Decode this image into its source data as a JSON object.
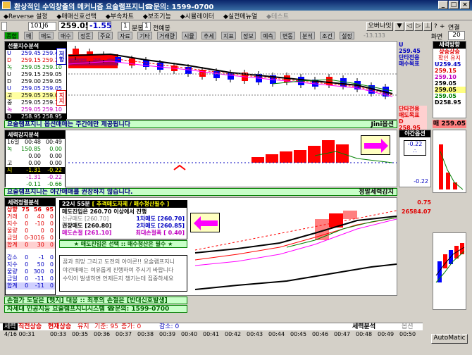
{
  "window": {
    "title": "환상적인 수익창출의 메커니즘 요술램프지니☎문의: 1599-0700",
    "btn_min": "_",
    "btn_max": "□",
    "btn_close": "×"
  },
  "menu": [
    "◆Reverse 설정",
    "◆매매신호선택",
    "◆부속차트",
    "◆보조기능",
    "◆시뮬레이터",
    "◆실전메뉴얼",
    "◆테스트"
  ],
  "toolbar": {
    "code": "101J6",
    "price": "259.05",
    "change": "-1.55",
    "period_value": "1",
    "period_unit": "분봉",
    "interval_value": "1",
    "interval_unit": "전예봉",
    "link_label": "오버나잇",
    "nav_prev": "◁",
    "nav_next": "▷",
    "zoom_label": "화면",
    "zoom_value": "20",
    "link2": "연결",
    "tabs": [
      "종합",
      "매",
      "매도",
      "매수",
      "정돈",
      "주요",
      "자료",
      "기타",
      "거래량",
      "시뮬",
      "추세",
      "지표",
      "정보",
      "예측",
      "변동",
      "분석",
      "조건",
      "설정"
    ],
    "tab_value": "-13.133"
  },
  "top_panel": {
    "header": "선물지수분석",
    "rows": [
      {
        "k": "U",
        "v1": "259.45",
        "v2": "259.45"
      },
      {
        "k": "D",
        "v1": "259.15",
        "v2": "259.20"
      },
      {
        "k": "녹",
        "v1": "259.05",
        "v2": "259.10"
      },
      {
        "k": "U",
        "v1": "259.15",
        "v2": "259.05"
      },
      {
        "k": "D",
        "v1": "259.00",
        "v2": "259.05"
      },
      {
        "k": "U",
        "v1": "259.05",
        "v2": "259.05"
      },
      {
        "k": "고",
        "v1": "259.05",
        "v2": "259.05"
      },
      {
        "k": "중",
        "v1": "259.05",
        "v2": "259.10"
      },
      {
        "k": "녹",
        "v1": "259.05",
        "v2": "259.10"
      },
      {
        "k": "D",
        "v1": "258.95",
        "v2": "258.95"
      },
      {
        "k": "흑",
        "v1": "0.49",
        "v2": "0.49"
      }
    ],
    "side_top": "저항",
    "side_bottom": "지지",
    "strip": "요술램프지니 옵션매매는 주간에만 제공됩니다",
    "strip_right": "Jini옵션"
  },
  "top_right": {
    "u_label": "U 259.45",
    "line2": "단타전용",
    "line3": "매수목표",
    "mid_label": "단타전용",
    "mid_label2": "매도목표",
    "d_label": "D 258.95",
    "tag": "매 259.05"
  },
  "right_column": {
    "header": "세력방향",
    "sub1": "상승상승",
    "sub2": "확인 유지",
    "values": [
      "U259.45",
      "259.15",
      "259.10",
      "259.05",
      "259.05",
      "259.05",
      "D258.95"
    ]
  },
  "mid_panel": {
    "header": "세력강지분석",
    "rows": [
      {
        "k": "16일",
        "v1": "00:48",
        "v2": "00:49"
      },
      {
        "k": "녹",
        "v1": "150.85",
        "v2": "0.00"
      },
      {
        "k": "",
        "v1": "0.00",
        "v2": "0.00"
      },
      {
        "k": "고",
        "v1": "0.00",
        "v2": "0.00"
      },
      {
        "k": "지",
        "v1": "-1.31",
        "v2": "-0.22"
      },
      {
        "k": "",
        "v1": "-1.31",
        "v2": "-0.22"
      },
      {
        "k": "",
        "v1": "-0.11",
        "v2": "-0.66"
      }
    ],
    "strip": "요술램프지니는 야간매매를 권장하지 않습니다.",
    "strip_right": "정말세력감지",
    "opt_header": "야간옵션",
    "opt_value": "-0.22",
    "opt_bottom": "-0.22",
    "opt_sym": "∴"
  },
  "bottom_panel": {
    "header": "세력정렬분석",
    "sub_header_time": "22시 55분",
    "sub_header_text": "[ 추격매도자제 / 매수청산필수 ]",
    "entry_line": "매도진입은 260.70 이상에서 진행",
    "row_a1": "신규매도 [260.70]",
    "row_a2": "1차매도 [260.70]",
    "row_b1": "권장매도 [260.80]",
    "row_b2": "2차매도 [260.85]",
    "row_c1": "매도손절 [261.10]",
    "row_c2": "최대손절폭 [ 0.40]",
    "star_line": "★ 매도진입은 선택 :: 매수청산은 필수 ★",
    "msg1": "꿈과 희망 그리고 도전의 아이콘!! 요술램프지니",
    "msg2": "야간매매는 여유롭게 진행하여 주시기 바랍니다",
    "msg3": "수익이 발생하면 언제든지 챙기는데 집중하세요",
    "table_header": [
      "상향",
      "75",
      "56",
      "95"
    ],
    "table": [
      {
        "k": "거래",
        "v1": "0",
        "v2": "40",
        "v3": "0"
      },
      {
        "k": "지수",
        "v1": "0",
        "v2": "-10",
        "v3": "0"
      },
      {
        "k": "물량",
        "v1": "0",
        "v2": "0",
        "v3": "0"
      },
      {
        "k": "금일",
        "v1": "0",
        "v2": "-3016",
        "v3": "0"
      },
      {
        "k": "합계",
        "v1": "0",
        "v2": "30",
        "v3": "0"
      },
      {
        "k": "감소",
        "v1": "0",
        "v2": "-1",
        "v3": "0"
      },
      {
        "k": "지수",
        "v1": "0",
        "v2": "50",
        "v3": "0"
      },
      {
        "k": "물량",
        "v1": "0",
        "v2": "300",
        "v3": "0"
      },
      {
        "k": "금일",
        "v1": "0",
        "v2": "-11",
        "v3": "0"
      },
      {
        "k": "합계",
        "v1": "0",
        "v2": "-11",
        "v3": "0"
      }
    ],
    "strip1": "손절가 도달은 [헷지] 대응 :: 최후의 손절은 [반대신호발생]",
    "strip2": "차세대 인공지능 요술램프지니시스템 ☎문의: 1599-0700",
    "right_top": "0.75",
    "right_val": "26584.07"
  },
  "status": {
    "label1": "세력",
    "label2": "직전상승",
    "label3": "현재상승",
    "label4": "유지",
    "label5": "기준: 95",
    "label6": "증가: 0",
    "label7": "감소: 0",
    "label8": "세력분석",
    "label9": "옵션"
  },
  "time_axis": [
    "4/16 00:31",
    "00:33",
    "00:35",
    "00:36",
    "00:37",
    "00:38",
    "00:39",
    "00:40",
    "00:41",
    "00:42",
    "00:43",
    "00:44",
    "00:45",
    "00:46",
    "00:47",
    "00:48",
    "00:49",
    "00:50"
  ],
  "auto_btn": "AutoMatic",
  "colors": {
    "up": "#ff0000",
    "down": "#0000ff",
    "green_strip": "#c8ffc8",
    "magenta": "#ff00ff"
  }
}
